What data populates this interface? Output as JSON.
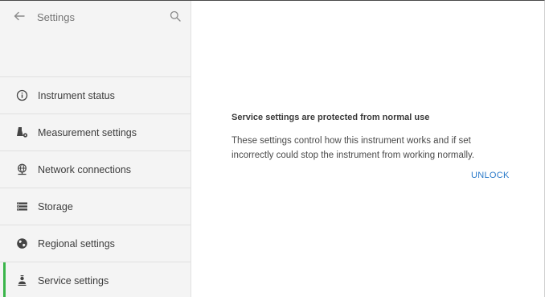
{
  "header": {
    "title": "Settings",
    "back_icon": "arrow-left-icon",
    "search_icon": "search-icon"
  },
  "sidebar": {
    "items": [
      {
        "label": "Instrument status",
        "icon": "info-circle-icon",
        "active": false
      },
      {
        "label": "Measurement settings",
        "icon": "flask-gear-icon",
        "active": false
      },
      {
        "label": "Network connections",
        "icon": "globe-network-icon",
        "active": false
      },
      {
        "label": "Storage",
        "icon": "storage-icon",
        "active": false
      },
      {
        "label": "Regional settings",
        "icon": "world-icon",
        "active": false
      },
      {
        "label": "Service settings",
        "icon": "service-person-icon",
        "active": true
      }
    ]
  },
  "main": {
    "notice_title": "Service settings are protected from normal use",
    "notice_body": "These settings control how this instrument works and if set incorrectly could stop the instrument from working normally.",
    "unlock_label": "UNLOCK"
  },
  "colors": {
    "accent_active": "#3ab54a",
    "link": "#2979c9",
    "sidebar_bg": "#f4f4f4"
  }
}
